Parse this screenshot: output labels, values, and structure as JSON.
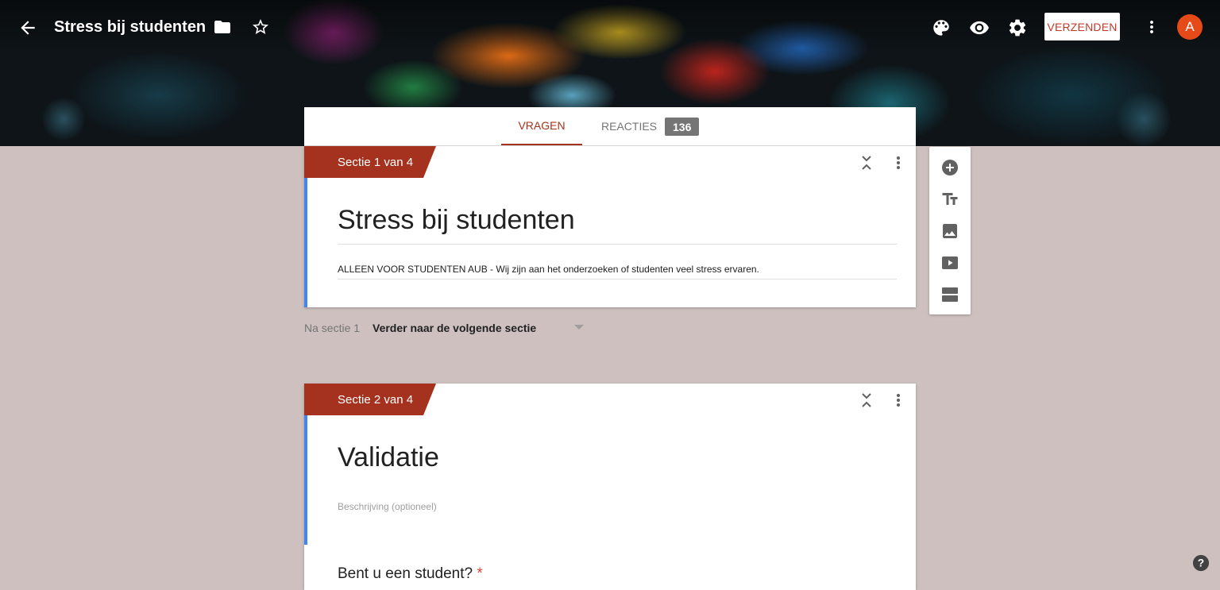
{
  "header": {
    "back_icon": "arrow-back-icon",
    "title": "Stress bij studenten",
    "send_label": "VERZENDEN",
    "avatar_letter": "A",
    "avatar_color": "#e64a19"
  },
  "tabs": {
    "questions_label": "VRAGEN",
    "responses_label": "REACTIES",
    "responses_count": "136",
    "active_color": "#a5321f"
  },
  "sections": [
    {
      "tag": "Sectie 1 van 4",
      "title": "Stress bij studenten",
      "description": "ALLEEN VOOR STUDENTEN AUB - Wij zijn aan het onderzoeken of studenten veel stress ervaren."
    },
    {
      "tag": "Sectie 2 van 4",
      "title": "Validatie",
      "description_placeholder": "Beschrijving (optioneel)",
      "question": "Bent u een student?",
      "required_mark": "*"
    }
  ],
  "after_section": {
    "label": "Na sectie 1",
    "value": "Verder naar de volgende sectie"
  },
  "toolbar": {
    "items": [
      "add-question-icon",
      "add-title-icon",
      "add-image-icon",
      "add-video-icon",
      "add-section-icon"
    ]
  },
  "colors": {
    "accent": "#a5321f",
    "section_border": "#4285f4",
    "background": "#cdc0bf"
  }
}
